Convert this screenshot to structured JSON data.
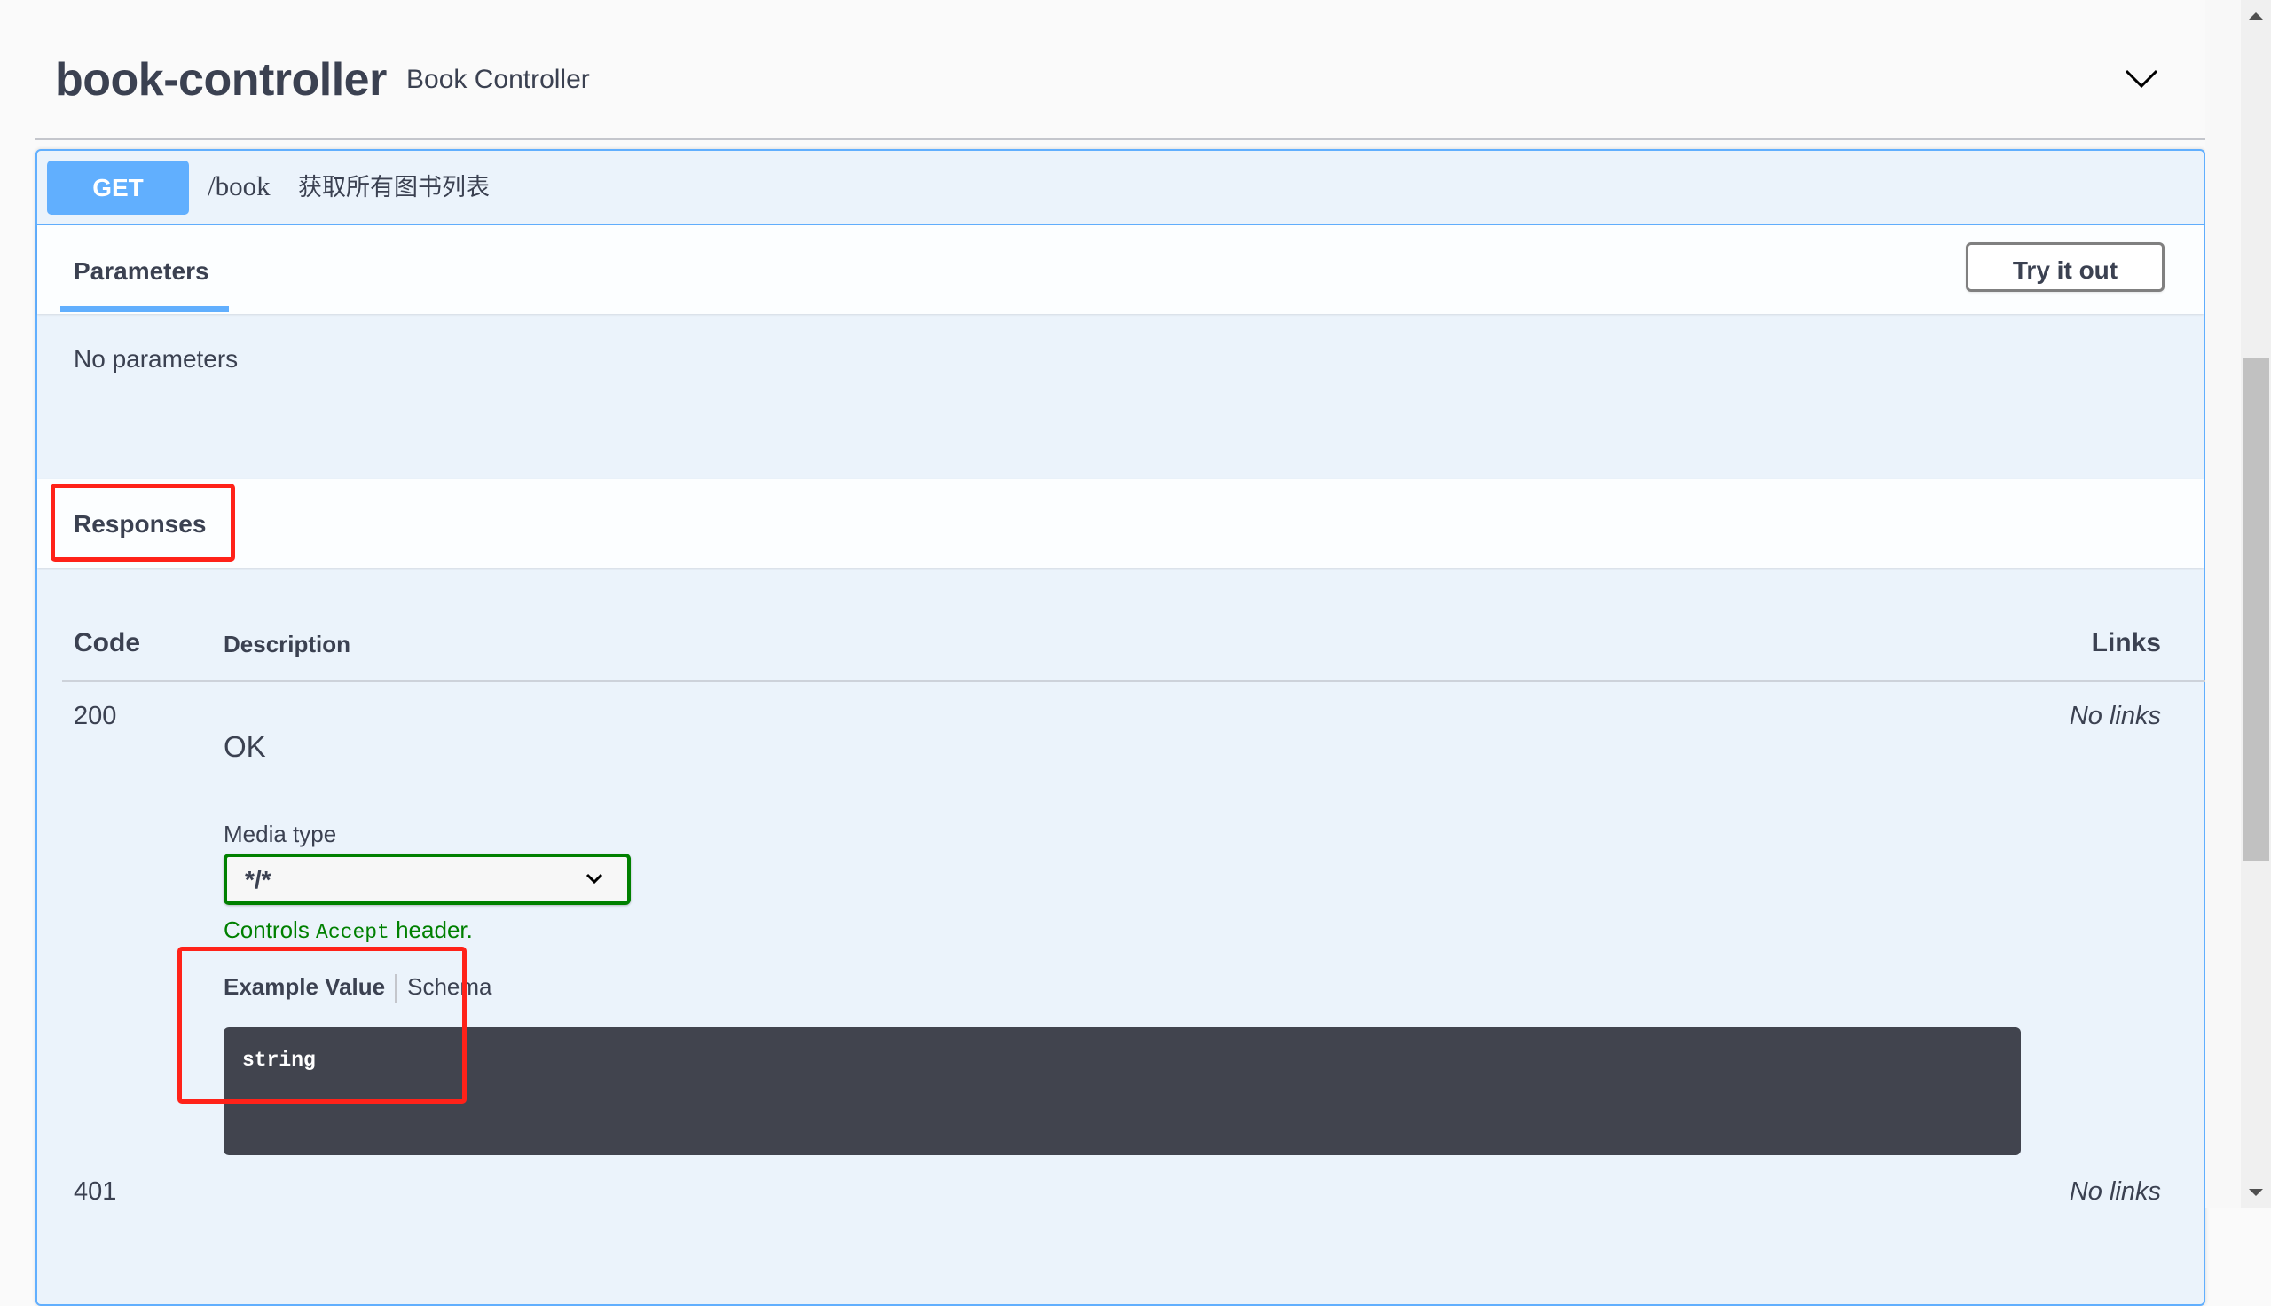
{
  "tag": {
    "name": "book-controller",
    "description": "Book Controller",
    "toggle_icon": "chevron-down-icon"
  },
  "operation": {
    "method": "GET",
    "path": "/book",
    "summary": "获取所有图书列表",
    "method_color": "#61affe"
  },
  "parameters": {
    "tab_label": "Parameters",
    "try_button": "Try it out",
    "empty_text": "No parameters"
  },
  "responses": {
    "title": "Responses",
    "columns": {
      "code": "Code",
      "description": "Description",
      "links": "Links"
    },
    "rows": [
      {
        "code": "200",
        "description": "OK",
        "links": "No links",
        "media_type_label": "Media type",
        "media_type_value": "*/*",
        "controls_prefix": "Controls ",
        "controls_code": "Accept",
        "controls_suffix": " header.",
        "example_tabs": [
          "Example Value",
          "Schema"
        ],
        "example_value": "string"
      },
      {
        "code": "401",
        "links": "No links"
      }
    ]
  },
  "colors": {
    "accent_blue": "#61affe",
    "highlight_red": "#ff2219",
    "media_green": "#008000",
    "code_bg": "#41444e"
  }
}
